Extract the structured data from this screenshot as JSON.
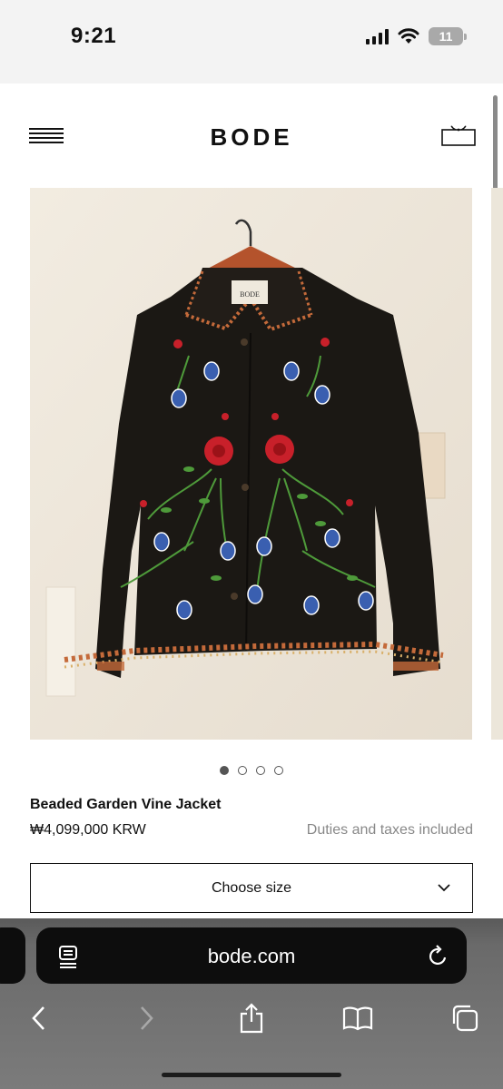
{
  "status_bar": {
    "time": "9:21",
    "battery": "11",
    "icons": [
      "cellular-signal-icon",
      "wifi-icon",
      "battery-icon"
    ]
  },
  "header": {
    "logo": "BODE",
    "icons": [
      "menu-icon",
      "shopping-bag-icon"
    ]
  },
  "carousel": {
    "total_images": 4,
    "active_index": 0
  },
  "product": {
    "name": "Beaded Garden Vine Jacket",
    "price": "₩4,099,000 KRW",
    "tax_note": "Duties and taxes included",
    "label_tag": "BODE"
  },
  "size_select": {
    "label": "Choose size"
  },
  "browser": {
    "url": "bode.com",
    "icons": [
      "reader-icon",
      "reload-icon",
      "back-icon",
      "forward-icon",
      "share-icon",
      "bookmarks-icon",
      "tabs-icon"
    ]
  },
  "colors": {
    "jacket": "#1b1814",
    "wall": "#efe8dc",
    "embroidery_red": "#c8202a",
    "embroidery_blue": "#3a5fb0",
    "stem_green": "#4e9a3a"
  }
}
